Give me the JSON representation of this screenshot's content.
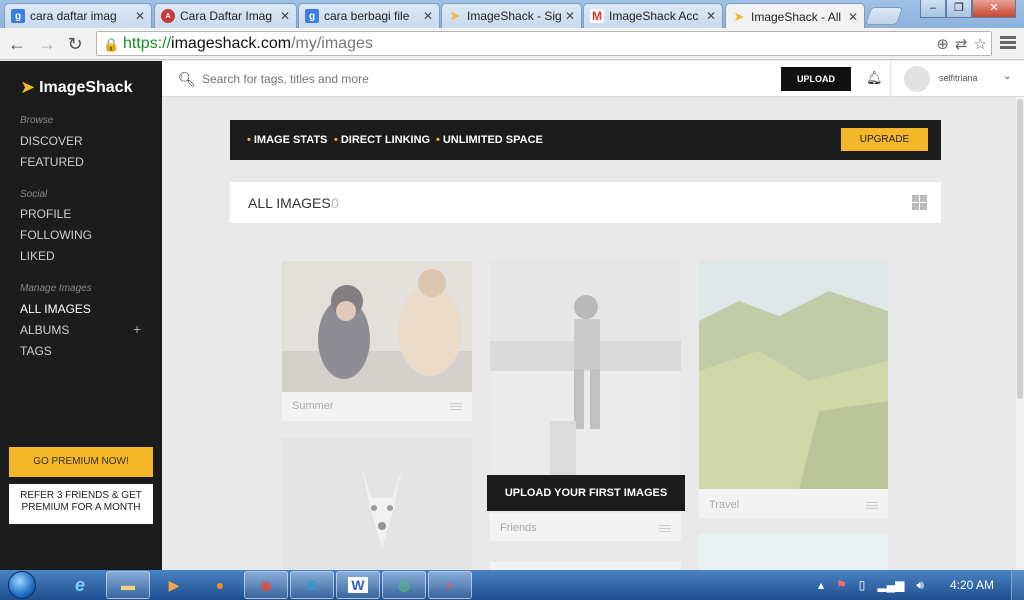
{
  "tabs": [
    {
      "title": "cara daftar imag",
      "fav": "g",
      "color": "#3b7de0"
    },
    {
      "title": "Cara Daftar Imag",
      "fav": "A",
      "color": "#c43a3a"
    },
    {
      "title": "cara berbagi file",
      "fav": "g",
      "color": "#3b7de0"
    },
    {
      "title": "ImageShack - Sig",
      "fav": "",
      "color": "#f5b72a"
    },
    {
      "title": "ImageShack Acc",
      "fav": "M",
      "color": "#d23c2a"
    },
    {
      "title": "ImageShack - All",
      "fav": "",
      "color": "#f5b72a",
      "active": true
    }
  ],
  "address": {
    "https": "https://",
    "host": "imageshack.com",
    "path": "/my/images"
  },
  "app": {
    "logo": "ImageShack",
    "search_placeholder": "Search for tags, titles and more",
    "upload": "UPLOAD",
    "username": "selfitriana"
  },
  "sidebar": {
    "browse_title": "Browse",
    "discover": "DISCOVER",
    "featured": "FEATURED",
    "social_title": "Social",
    "profile": "PROFILE",
    "following": "FOLLOWING",
    "liked": "LIKED",
    "manage_title": "Manage Images",
    "all_images": "ALL IMAGES",
    "albums": "ALBUMS",
    "tags": "TAGS",
    "plus": "+",
    "premium": "GO PREMIUM NOW!",
    "refer_line1": "REFER 3 FRIENDS & GET",
    "refer_line2": "PREMIUM FOR A MONTH"
  },
  "promo": {
    "features": [
      "IMAGE STATS",
      "DIRECT LINKING",
      "UNLIMITED SPACE"
    ],
    "upgrade": "UPGRADE"
  },
  "main": {
    "all_images_label": "ALL IMAGES",
    "count": "0",
    "upload_first": "UPLOAD YOUR FIRST IMAGES",
    "cards": [
      "Summer",
      "Friends",
      "Travel"
    ]
  },
  "taskbar": {
    "clock": "4:20 AM"
  }
}
